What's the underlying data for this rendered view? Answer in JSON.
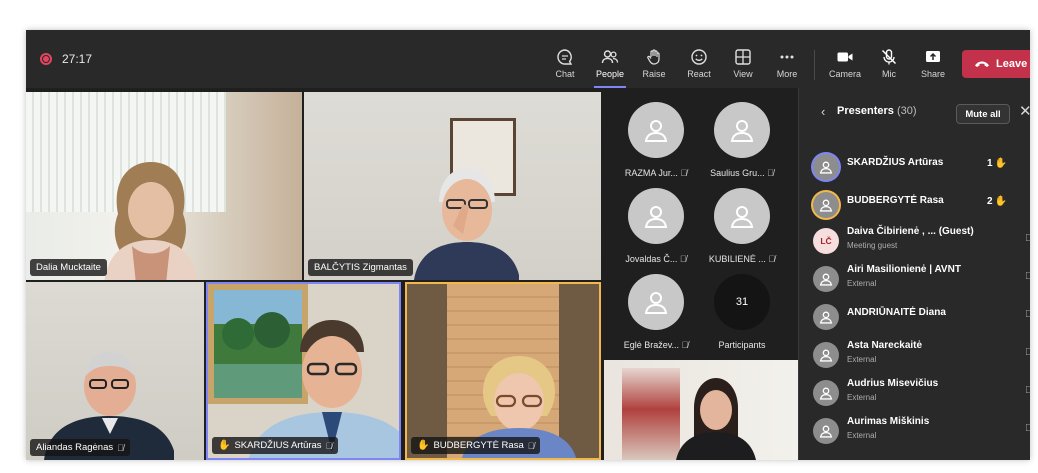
{
  "meeting": {
    "timer": "27:17",
    "recording": true
  },
  "toolbar": {
    "chat": "Chat",
    "people": "People",
    "raise": "Raise",
    "react": "React",
    "view": "View",
    "more": "More",
    "camera": "Camera",
    "mic": "Mic",
    "share": "Share",
    "leave": "Leave"
  },
  "video_tiles": [
    {
      "name": "Dalia Mucktaite"
    },
    {
      "name": "BALČYTIS Zigmantas"
    },
    {
      "name": "Aliandas Ragėnas"
    },
    {
      "name": "SKARDŽIUS Artūras",
      "hand_raised": true
    },
    {
      "name": "BUDBERGYTĖ Rasa",
      "hand_raised": true
    }
  ],
  "avatar_grid": [
    {
      "name": "RAZMA Jur..."
    },
    {
      "name": "Saulius Gru..."
    },
    {
      "name": "Jovaldas Č..."
    },
    {
      "name": "KUBILIENĖ ..."
    },
    {
      "name": "Eglė Bražev..."
    }
  ],
  "participants_tile": {
    "count": "31",
    "label": "Participants"
  },
  "panel": {
    "title": "Presenters",
    "count": "(30)",
    "mute_all": "Mute all",
    "people": [
      {
        "name": "SKARDŽIUS Artūras",
        "subtitle": "",
        "hand": "1"
      },
      {
        "name": "BUDBERGYTĖ Rasa",
        "subtitle": "",
        "hand": "2"
      },
      {
        "name": "Daiva Čibirienė , ... (Guest)",
        "subtitle": "Meeting guest",
        "initials": "LČ"
      },
      {
        "name": "Airi Masilionienė | AVNT",
        "subtitle": "External"
      },
      {
        "name": "ANDRIŪNAITĖ Diana",
        "subtitle": ""
      },
      {
        "name": "Asta Nareckaitė",
        "subtitle": "External"
      },
      {
        "name": "Audrius Misevičius",
        "subtitle": "External"
      },
      {
        "name": "Aurimas Miškinis",
        "subtitle": "External"
      }
    ]
  },
  "colors": {
    "accent": "#7f85f5",
    "leave": "#c4314b",
    "hand": "#f2b84b",
    "record": "#e2455f"
  }
}
